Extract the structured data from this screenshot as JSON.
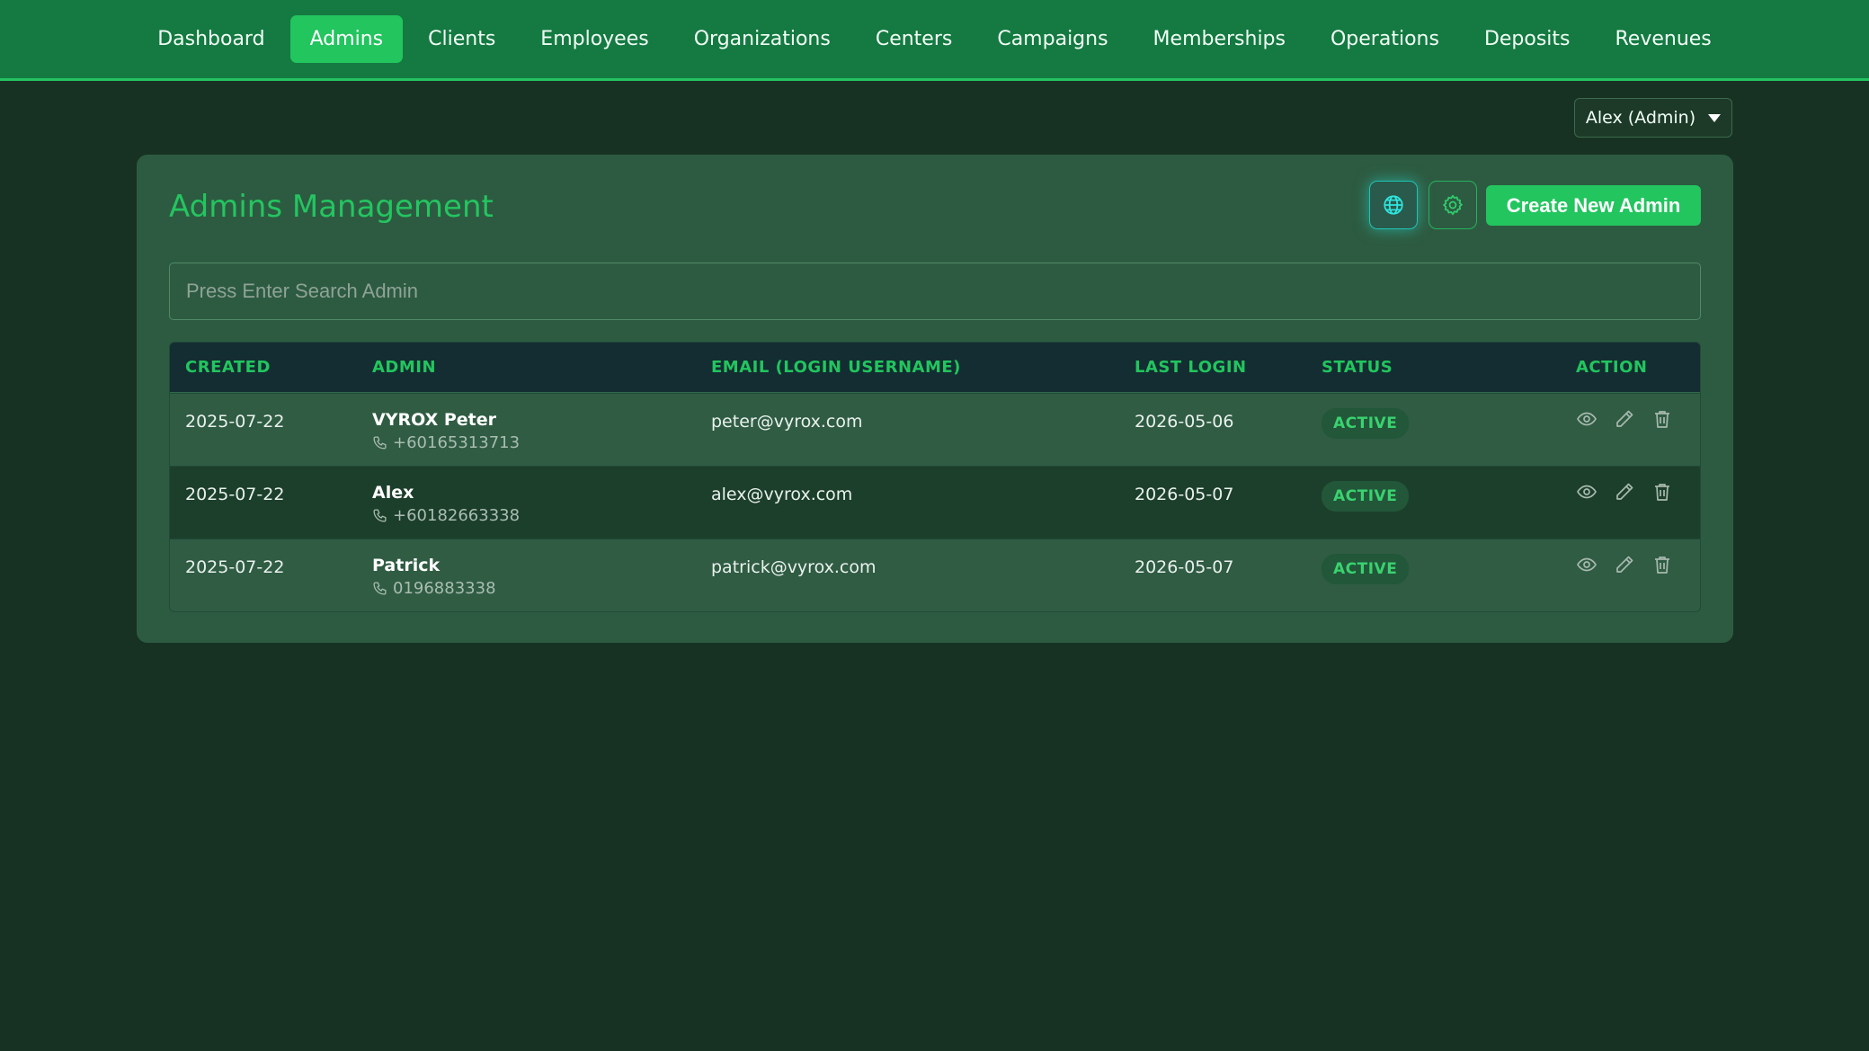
{
  "nav": {
    "items": [
      {
        "label": "Dashboard"
      },
      {
        "label": "Admins",
        "active": true
      },
      {
        "label": "Clients"
      },
      {
        "label": "Employees"
      },
      {
        "label": "Organizations"
      },
      {
        "label": "Centers"
      },
      {
        "label": "Campaigns"
      },
      {
        "label": "Memberships"
      },
      {
        "label": "Operations"
      },
      {
        "label": "Deposits"
      },
      {
        "label": "Revenues"
      }
    ]
  },
  "user_menu": {
    "label": "Alex (Admin)",
    "icon": "caret-down-icon"
  },
  "page": {
    "title": "Admins Management",
    "create_label": "Create New Admin",
    "icons": {
      "language": "globe-icon",
      "settings": "gear-icon"
    },
    "search_placeholder": "Press Enter Search Admin"
  },
  "table": {
    "headers": {
      "created": "CREATED",
      "admin": "ADMIN",
      "email": "EMAIL (LOGIN USERNAME)",
      "last_login": "LAST LOGIN",
      "status": "STATUS",
      "action": "ACTION"
    },
    "rows": [
      {
        "created": "2025-07-22",
        "name": "VYROX Peter",
        "phone": "+60165313713",
        "email": "peter@vyrox.com",
        "last_login": "2026-05-06",
        "status": "ACTIVE"
      },
      {
        "created": "2025-07-22",
        "name": "Alex",
        "phone": "+60182663338",
        "email": "alex@vyrox.com",
        "last_login": "2026-05-07",
        "status": "ACTIVE"
      },
      {
        "created": "2025-07-22",
        "name": "Patrick",
        "phone": "0196883338",
        "email": "patrick@vyrox.com",
        "last_login": "2026-05-07",
        "status": "ACTIVE"
      }
    ],
    "row_icons": {
      "phone": "phone-icon",
      "view": "eye-icon",
      "edit": "pencil-icon",
      "delete": "trash-icon"
    }
  },
  "colors": {
    "background": "#173222",
    "nav": "#147a41",
    "accent": "#22c55e",
    "card": "#2d5b41",
    "table_header": "#132d32"
  }
}
